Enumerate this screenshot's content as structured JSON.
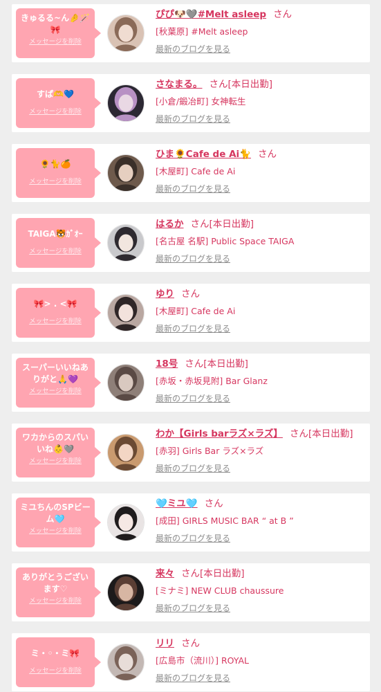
{
  "delete_label": "メッセージを削除",
  "blog_label": "最新のブログを見る",
  "san_label": "さん",
  "colors": {
    "bubble": "#ffa5b1",
    "accent": "#d6365f",
    "muted": "#8e8e8e",
    "background": "#eeeeee"
  },
  "entries": [
    {
      "message": "きゅるる~ん🤌🪄🎀",
      "name": "ぴぴ🐶🩶#Melt asleep",
      "work_today": "",
      "shop": "[秋葉原] #Melt asleep",
      "avatar_palette": [
        "#d9c2b4",
        "#f0dcd1",
        "#8a6a58"
      ]
    },
    {
      "message": "すぱ🫶💙",
      "name": "さなまる。",
      "work_today": "[本日出勤]",
      "shop": "[小倉/鍛冶町] 女神転生",
      "avatar_palette": [
        "#2c2833",
        "#e9d8e4",
        "#b891c4"
      ]
    },
    {
      "message": "🌻🐈🍊",
      "name": "ひま🌻Cafe de Ai🐈",
      "work_today": "",
      "shop": "[木屋町] Cafe de Ai",
      "avatar_palette": [
        "#6e5a4c",
        "#e6cfc0",
        "#3a2f29"
      ]
    },
    {
      "message": "TAIGA🐯ｶﾞｵｰ",
      "name": "はるか",
      "work_today": "[本日出勤]",
      "shop": "[名古屋 名駅] Public Space TAIGA",
      "avatar_palette": [
        "#c9c9cc",
        "#f2e6df",
        "#2e2a30"
      ]
    },
    {
      "message": "🎀> . <🎀",
      "name": "ゆり",
      "work_today": "",
      "shop": "[木屋町] Cafe de Ai",
      "avatar_palette": [
        "#b9a7a1",
        "#f3e2dc",
        "#2f2627"
      ]
    },
    {
      "message": "スーパーいいねありがと🙏💜",
      "name": "18号",
      "work_today": "[本日出勤]",
      "shop": "[赤坂・赤坂見附] Bar Glanz",
      "avatar_palette": [
        "#8e7f78",
        "#d9c9c0",
        "#5a4a45"
      ]
    },
    {
      "message": "ワカからのスパいいね👶🩶",
      "name": "わか【Girls barラズ×ラズ】",
      "work_today": "[本日出勤]",
      "shop": "[赤羽] Girls Bar ラズ×ラズ",
      "avatar_palette": [
        "#c99a6f",
        "#f3d6c4",
        "#6b4a33"
      ]
    },
    {
      "message": "ミユちんのSPビーム🩵",
      "name": "🩵ミユ🩵",
      "work_today": "",
      "shop": "[成田] GIRLS MUSIC BAR “ at B ”",
      "avatar_palette": [
        "#e9e4e4",
        "#f6e8e4",
        "#1f1c1d"
      ]
    },
    {
      "message": "ありがとうございます♡",
      "name": "来々",
      "work_today": "[本日出勤]",
      "shop": "[ミナミ] NEW CLUB chaussure",
      "avatar_palette": [
        "#1c1a1b",
        "#d7b6a3",
        "#5a3e34"
      ]
    },
    {
      "message": "ミ・◦・ミ🎀",
      "name": "リリ",
      "work_today": "",
      "shop": "[広島市（流川）] ROYAL",
      "avatar_palette": [
        "#c3b8b4",
        "#e8ddd8",
        "#7a6258"
      ]
    }
  ]
}
